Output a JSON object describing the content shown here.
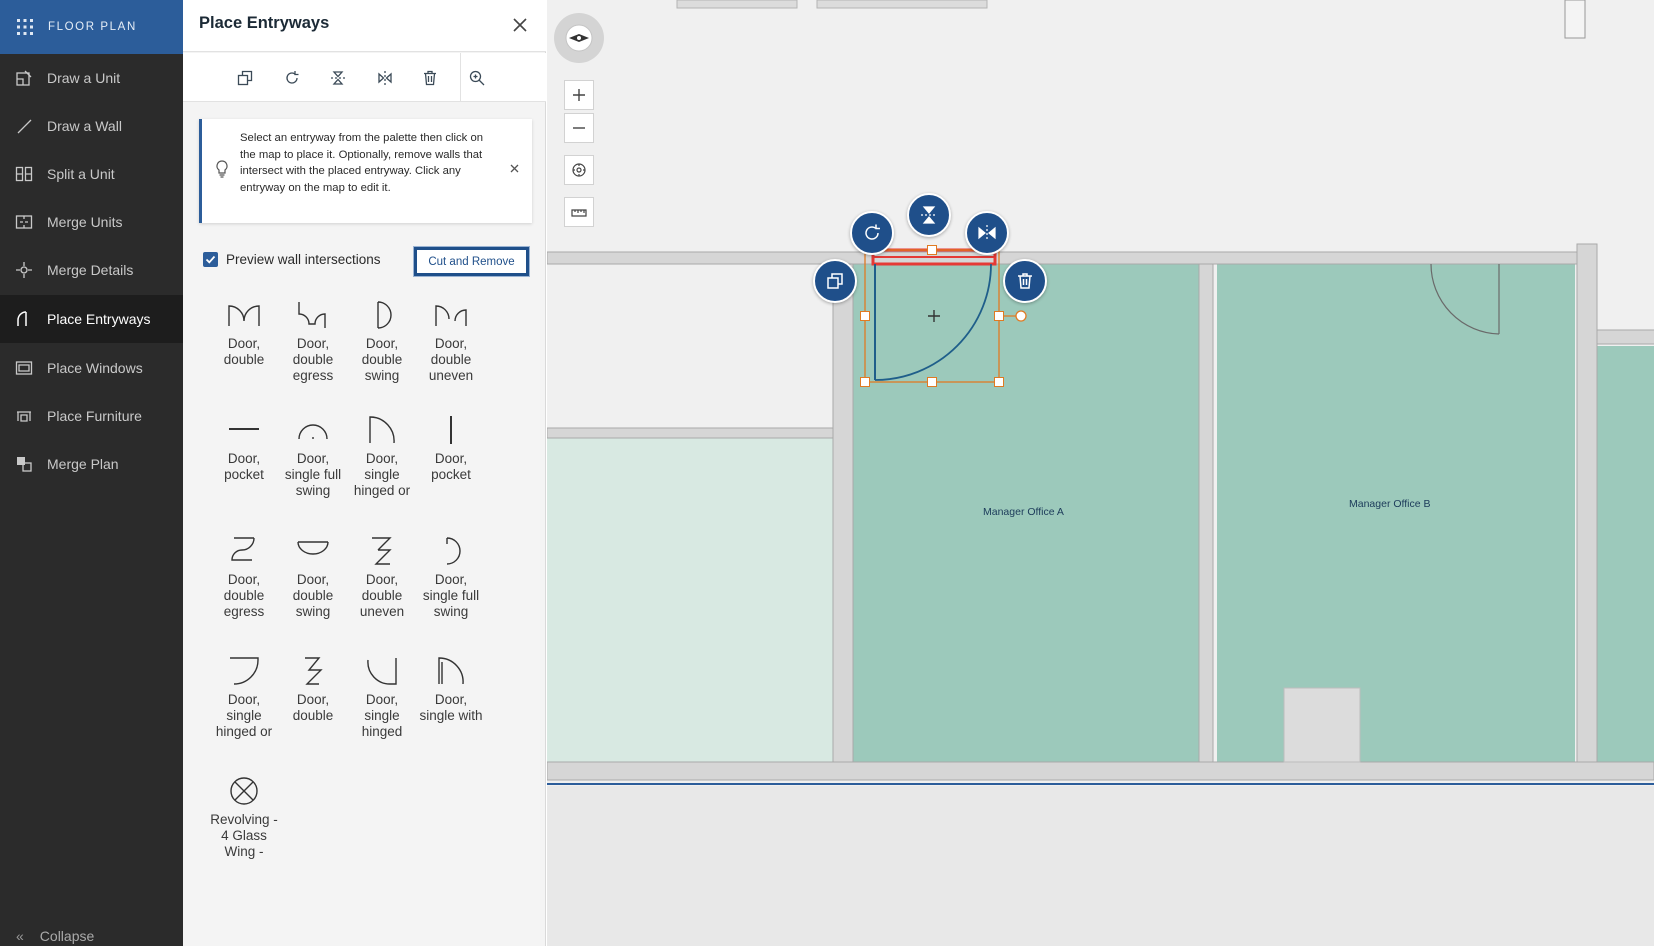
{
  "app": {
    "title": "FLOOR PLAN"
  },
  "sidebar": {
    "items": [
      {
        "label": "Draw a Unit",
        "icon": "draw-unit-icon"
      },
      {
        "label": "Draw a Wall",
        "icon": "draw-wall-icon"
      },
      {
        "label": "Split a Unit",
        "icon": "split-unit-icon"
      },
      {
        "label": "Merge Units",
        "icon": "merge-units-icon"
      },
      {
        "label": "Merge Details",
        "icon": "merge-details-icon"
      },
      {
        "label": "Place Entryways",
        "icon": "entryway-icon",
        "active": true
      },
      {
        "label": "Place Windows",
        "icon": "window-icon"
      },
      {
        "label": "Place Furniture",
        "icon": "furniture-icon"
      },
      {
        "label": "Merge Plan",
        "icon": "merge-plan-icon"
      }
    ],
    "collapse_label": "Collapse"
  },
  "panel": {
    "title": "Place Entryways",
    "notice": "Select an entryway from the palette then click on the map to place it. Optionally, remove walls that intersect with the placed entryway. Click any entryway on the map to edit it.",
    "preview_label": "Preview wall intersections",
    "preview_checked": true,
    "cut_button": "Cut and Remove",
    "palette": [
      {
        "label": "Door, double",
        "icon": "door-double-icon"
      },
      {
        "label": "Door, double egress",
        "icon": "door-double-egress-icon"
      },
      {
        "label": "Door, double swing",
        "icon": "door-double-swing-icon"
      },
      {
        "label": "Door, double uneven",
        "icon": "door-double-uneven-icon"
      },
      {
        "label": "Door, pocket",
        "icon": "door-pocket-icon"
      },
      {
        "label": "Door, single full swing",
        "icon": "door-single-full-swing-icon"
      },
      {
        "label": "Door, single hinged or",
        "icon": "door-single-hinged-icon"
      },
      {
        "label": "Door, pocket",
        "icon": "door-pocket-vertical-icon"
      },
      {
        "label": "Door, double egress",
        "icon": "door-double-egress-icon"
      },
      {
        "label": "Door, double swing",
        "icon": "door-double-swing-icon"
      },
      {
        "label": "Door, double uneven",
        "icon": "door-double-uneven-icon"
      },
      {
        "label": "Door, single full swing",
        "icon": "door-single-full-swing-icon"
      },
      {
        "label": "Door, single hinged or",
        "icon": "door-single-hinged-icon"
      },
      {
        "label": "Door, double",
        "icon": "door-double-icon"
      },
      {
        "label": "Door, single hinged",
        "icon": "door-single-hinged-icon"
      },
      {
        "label": "Door, single with",
        "icon": "door-single-with-icon"
      },
      {
        "label": "Revolving - 4 Glass Wing -",
        "icon": "revolving-door-icon"
      }
    ]
  },
  "map": {
    "rooms": [
      {
        "label": "Manager Office A"
      },
      {
        "label": "Manager Office B"
      }
    ]
  },
  "colors": {
    "accent": "#2c5d9a",
    "sidebar_bg": "#2b2b2b",
    "room_fill": "#9cc9bb",
    "room_fill_light": "#d8e9e2",
    "selection": "#e07a22",
    "cut_highlight": "#e53935"
  }
}
